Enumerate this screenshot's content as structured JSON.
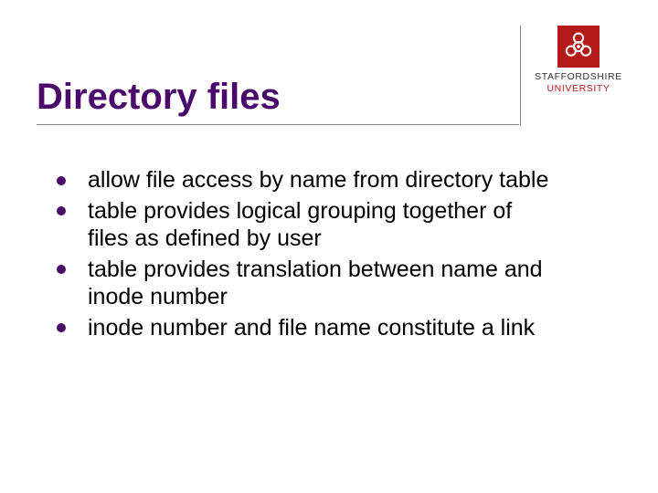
{
  "logo": {
    "line1": "STAFFORDSHIRE",
    "line2": "UNIVERSITY"
  },
  "title": "Directory files",
  "bullets": [
    "allow file access by name from directory table",
    "table provides logical grouping together of files as defined by user",
    "table provides translation between name and inode number",
    "inode number and file name constitute a link"
  ]
}
